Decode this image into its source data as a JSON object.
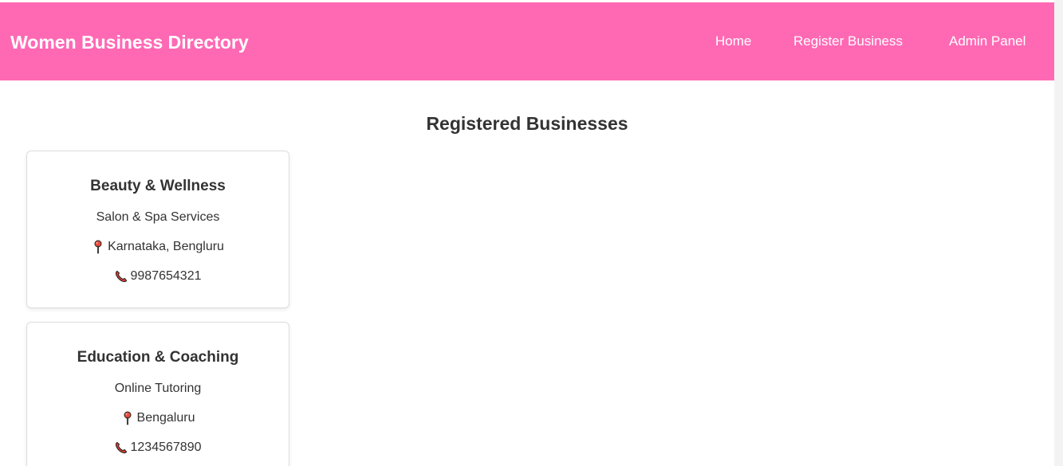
{
  "header": {
    "brand": "Women Business Directory",
    "nav": [
      {
        "label": "Home"
      },
      {
        "label": "Register Business"
      },
      {
        "label": "Admin Panel"
      }
    ],
    "background_color": "#ff69b4"
  },
  "main": {
    "title": "Registered Businesses",
    "businesses": [
      {
        "name": "Beauty & Wellness",
        "service": "Salon & Spa Services",
        "location": "Karnataka, Bengluru",
        "phone": "9987654321",
        "location_icon": "pushpin-icon",
        "phone_icon": "telephone-receiver-icon"
      },
      {
        "name": "Education & Coaching",
        "service": "Online Tutoring",
        "location": "Bengaluru",
        "phone": "1234567890",
        "location_icon": "pushpin-icon",
        "phone_icon": "telephone-receiver-icon"
      }
    ]
  }
}
